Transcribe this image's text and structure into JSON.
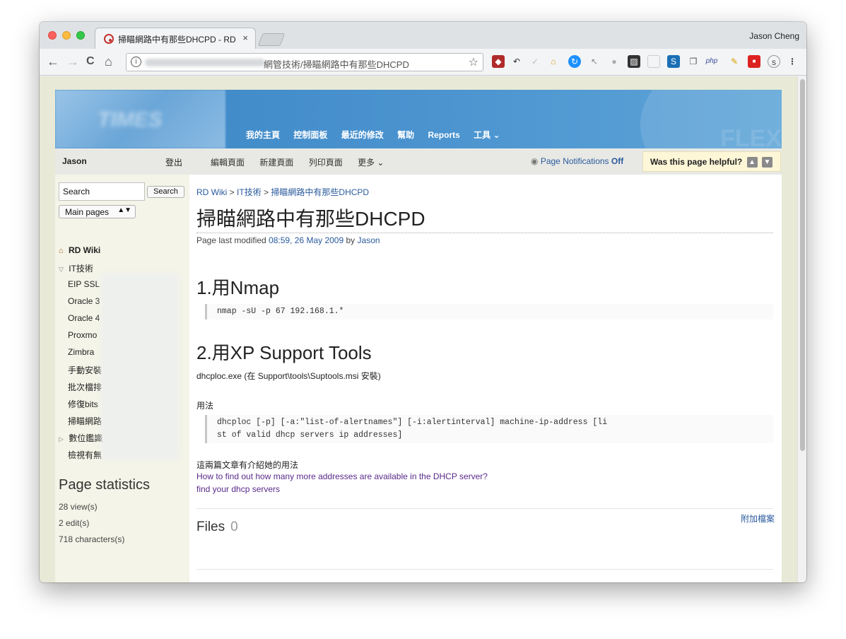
{
  "browser": {
    "tab_title": "掃瞄網路中有那些DHCPD - RD",
    "tab_close": "×",
    "profile_name": "Jason Cheng",
    "url_visible": "網管技術/掃瞄網路中有那些DHCPD",
    "nav": {
      "back": "←",
      "forward": "→",
      "reload": "C",
      "home": "⌂",
      "info": "i",
      "star": "☆"
    },
    "extensions": [
      "shield-ext-icon",
      "undo-ext-icon",
      "check-ext-icon",
      "colorful-ext-icon",
      "sync-ext-icon",
      "cursor-ext-icon",
      "circle-ext-icon",
      "photo-ext-icon",
      "blank-ext-icon",
      "s-ext-icon",
      "copy-ext-icon",
      "php-ext-icon",
      "broom-ext-icon",
      "flag-ext-icon",
      "s-circle-ext-icon",
      "menu-icon"
    ],
    "ext_labels": {
      "php": "php",
      "s": "S"
    }
  },
  "wiki": {
    "topnav": [
      "我的主頁",
      "控制面板",
      "最近的修改",
      "幫助",
      "Reports",
      "工具 ⌄"
    ],
    "user": "Jason",
    "logout": "登出",
    "page_actions": [
      "編輯頁面",
      "新建頁面",
      "列印頁面",
      "更多 ⌄"
    ],
    "notifications": {
      "label": "Page Notifications",
      "state": "Off"
    },
    "helpful": "Was this page helpful?",
    "sidebar": {
      "search_placeholder": "Search",
      "search_button": "Search",
      "main_select": "Main pages",
      "tree": [
        {
          "label": "RD Wiki",
          "indent": 0,
          "icon": "home-icon",
          "bold": true
        },
        {
          "label": "IT技術",
          "indent": 0,
          "icon": "triangle-down-icon",
          "bold": false
        },
        {
          "label": "EIP SSL",
          "indent": 1
        },
        {
          "label": "Oracle 3",
          "indent": 1
        },
        {
          "label": "Oracle 4",
          "indent": 1
        },
        {
          "label": "Proxmo",
          "indent": 1
        },
        {
          "label": "Zimbra",
          "indent": 1
        },
        {
          "label": "手動安裝",
          "indent": 1
        },
        {
          "label": "批次檔排",
          "indent": 1
        },
        {
          "label": "修復bits",
          "indent": 1
        },
        {
          "label": "掃瞄網路",
          "indent": 1
        },
        {
          "label": "數位鑑識",
          "indent": 0,
          "icon": "triangle-right-icon"
        },
        {
          "label": "檢視有無",
          "indent": 1
        }
      ],
      "stats_title": "Page statistics",
      "stats": [
        "28 view(s)",
        "2 edit(s)",
        "718 characters(s)"
      ]
    },
    "content": {
      "breadcrumb": [
        "RD Wiki",
        "IT技術",
        "掃瞄網路中有那些DHCPD"
      ],
      "breadcrumb_sep": ">",
      "title": "掃瞄網路中有那些DHCPD",
      "modified_prefix": "Page last modified",
      "modified_time": "08:59, 26 May 2009",
      "modified_by_prefix": "by",
      "modified_by": "Jason",
      "section1_title": "1.用Nmap",
      "section1_code": "nmap -sU -p 67 192.168.1.*",
      "section2_title": "2.用XP Support Tools",
      "section2_text": "dhcploc.exe (在 Support\\tools\\Suptools.msi 安裝)",
      "usage_label": "用法",
      "usage_code_line1": "dhcploc [-p] [-a:\"list-of-alertnames\"] [-i:alertinterval] machine-ip-address [li",
      "usage_code_line2": "st of valid dhcp servers ip addresses]",
      "ref_text": "這兩篇文章有介紹她的用法",
      "ref_link1": "How to find out how many more addresses are available in the DHCP server?",
      "ref_link2": "find your dhcp servers",
      "files_label": "Files",
      "files_count": "0",
      "attach_label": "附加檔案"
    }
  }
}
